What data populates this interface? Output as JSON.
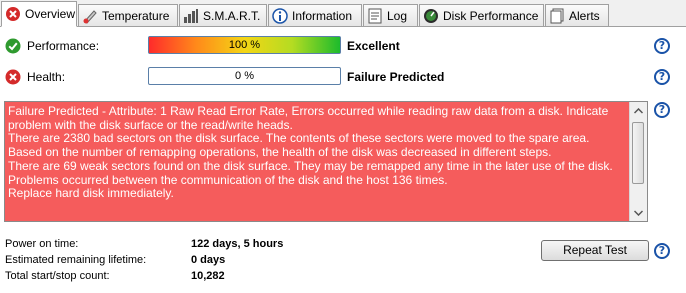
{
  "tabs": [
    {
      "label": "Overview",
      "icon": "overview-error-icon",
      "active": true
    },
    {
      "label": "Temperature",
      "icon": "thermometer-icon",
      "active": false
    },
    {
      "label": "S.M.A.R.T.",
      "icon": "smart-bars-icon",
      "active": false
    },
    {
      "label": "Information",
      "icon": "info-icon",
      "active": false
    },
    {
      "label": "Log",
      "icon": "log-document-icon",
      "active": false
    },
    {
      "label": "Disk Performance",
      "icon": "gauge-icon",
      "active": false
    },
    {
      "label": "Alerts",
      "icon": "alerts-icon",
      "active": false
    }
  ],
  "performance": {
    "label": "Performance:",
    "meter_text": "100 %",
    "meter_percent": 100,
    "value": "Excellent",
    "status_icon": "check-icon"
  },
  "health": {
    "label": "Health:",
    "meter_text": "0 %",
    "meter_percent": 0,
    "value": "Failure Predicted",
    "status_icon": "error-x-icon"
  },
  "message": {
    "text": "Failure Predicted - Attribute: 1 Raw Read Error Rate, Errors occurred while reading raw data from a disk. Indicate\nproblem with the disk surface or the read/write heads.\nThere are 2380 bad sectors on the disk surface. The contents of these sectors were moved to the spare area.\nBased on the number of remapping operations, the health of the disk was decreased in different steps.\nThere are 69 weak sectors found on the disk surface. They may be remapped any time in the later use of the disk.\nProblems occurred between the communication of the disk and the host 136 times.\nReplace hard disk immediately."
  },
  "info": [
    {
      "label": "Power on time:",
      "value": "122 days, 5 hours"
    },
    {
      "label": "Estimated remaining lifetime:",
      "value": "0 days"
    },
    {
      "label": "Total start/stop count:",
      "value": "10,282"
    }
  ],
  "repeat_button": "Repeat Test",
  "help_glyph": "?",
  "colors": {
    "message_background": "#f55c5c",
    "help_blue": "#1a53a8",
    "ok_green": "#2f9a2f",
    "error_red": "#d42a2a"
  }
}
